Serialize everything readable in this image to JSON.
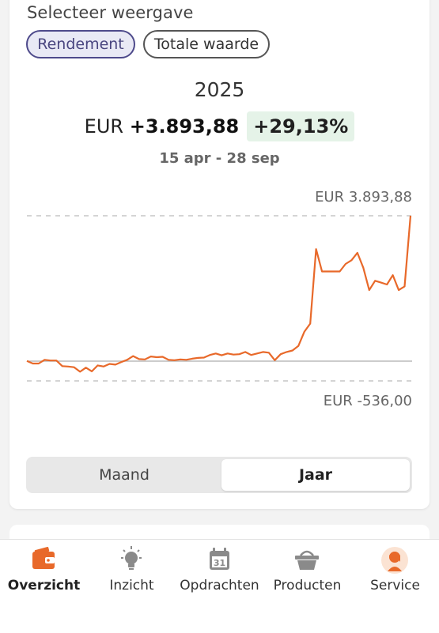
{
  "header": {
    "title": "Selecteer weergave"
  },
  "view_chips": [
    {
      "label": "Rendement",
      "active": true
    },
    {
      "label": "Totale waarde",
      "active": false
    }
  ],
  "summary": {
    "year": "2025",
    "currency": "EUR",
    "amount": "+3.893,88",
    "percentage": "+29,13%",
    "date_range": "15 apr - 28 sep"
  },
  "chart_labels": {
    "max": "EUR 3.893,88",
    "min": "EUR -536,00"
  },
  "chart_data": {
    "type": "line",
    "title": "",
    "xlabel": "",
    "ylabel": "",
    "x_range": [
      "15 apr",
      "28 sep"
    ],
    "ylim": [
      -536.0,
      3893.88
    ],
    "grid": false,
    "legend": "none",
    "line_color": "#e8692a",
    "series": [
      {
        "values": [
          0,
          -70,
          -70,
          30,
          10,
          10,
          -140,
          -150,
          -170,
          -290,
          -180,
          -280,
          -120,
          -150,
          -80,
          -100,
          -30,
          30,
          130,
          50,
          40,
          120,
          100,
          110,
          30,
          20,
          40,
          30,
          60,
          80,
          90,
          160,
          200,
          150,
          200,
          170,
          180,
          240,
          160,
          200,
          240,
          220,
          20,
          180,
          240,
          280,
          400,
          780,
          1000,
          3000,
          2400,
          2400,
          2400,
          2400,
          2600,
          2700,
          2900,
          2500,
          1900,
          2150,
          2100,
          2050,
          2300,
          1900,
          2000,
          3893.88
        ]
      }
    ]
  },
  "period_toggle": {
    "options": [
      "Maand",
      "Jaar"
    ],
    "selected": "Jaar"
  },
  "nav": {
    "items": [
      {
        "label": "Overzicht",
        "icon": "wallet-icon",
        "active": true
      },
      {
        "label": "Inzicht",
        "icon": "lightbulb-icon",
        "active": false
      },
      {
        "label": "Opdrachten",
        "icon": "calendar-icon",
        "active": false,
        "icon_text": "31"
      },
      {
        "label": "Producten",
        "icon": "basket-icon",
        "active": false
      },
      {
        "label": "Service",
        "icon": "service-avatar-icon",
        "active": false
      }
    ]
  },
  "colors": {
    "accent": "#e8692a",
    "chip_active": "#4e4a8b",
    "pct_bg": "#e5f3e8"
  }
}
